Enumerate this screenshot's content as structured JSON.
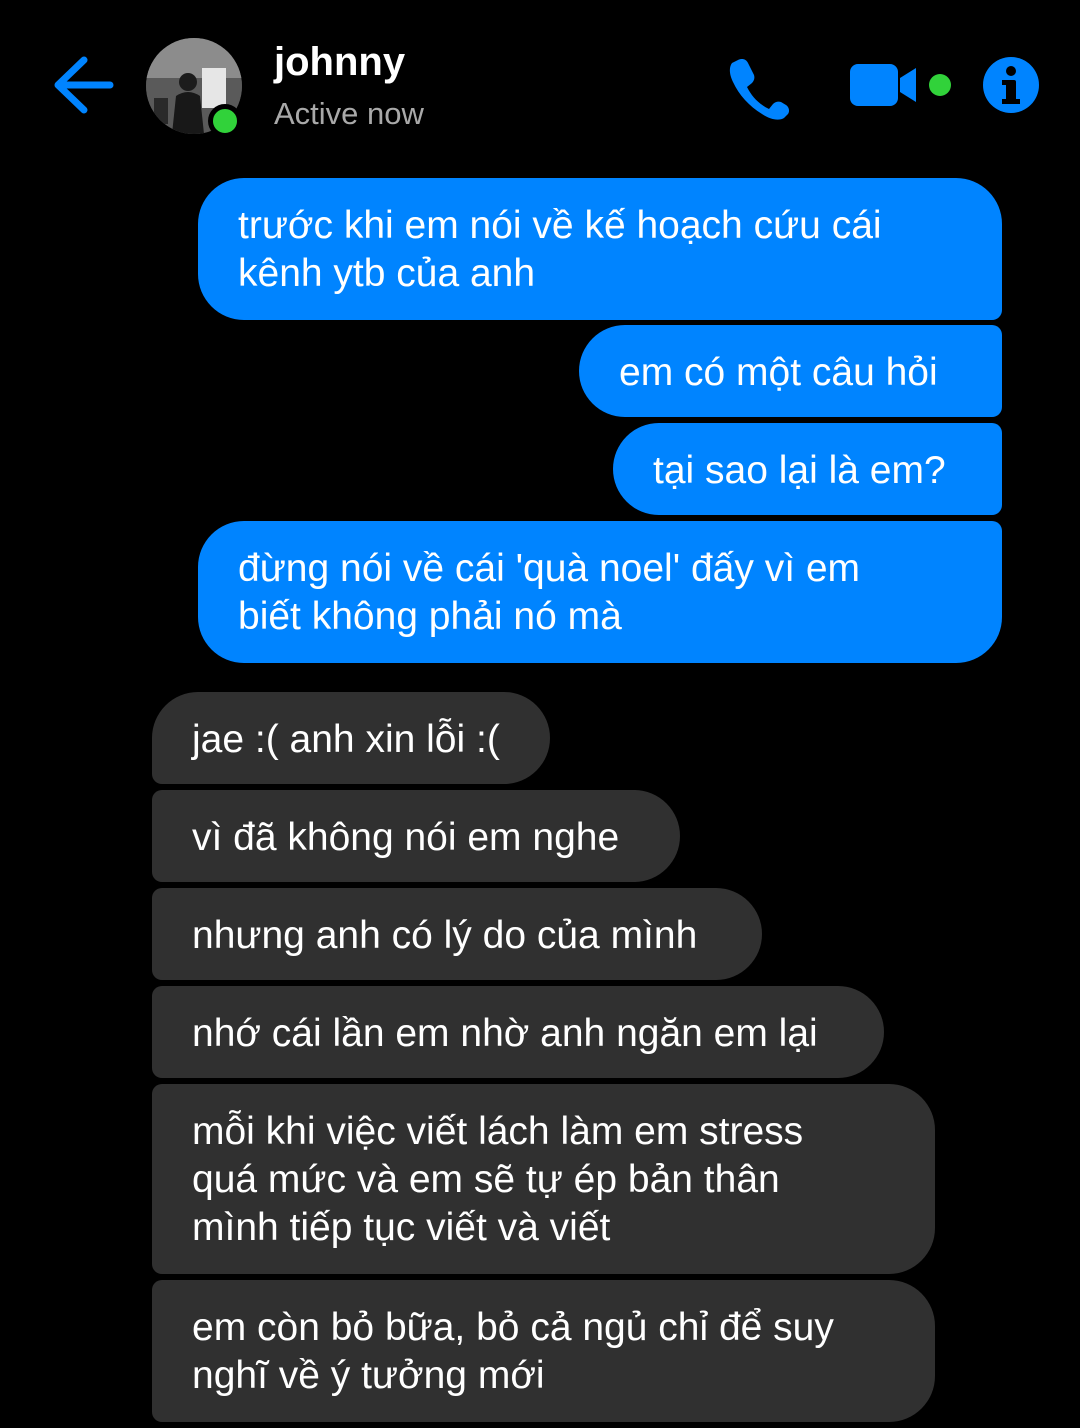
{
  "header": {
    "contact_name": "johnny",
    "status": "Active now",
    "icons": [
      "back-arrow-icon",
      "phone-icon",
      "video-camera-icon",
      "info-icon"
    ],
    "accent_color": "#0084ff",
    "online_color": "#31d23a"
  },
  "messages": {
    "outgoing": [
      {
        "lines": [
          "trước khi em nói về kế hoạch cứu cái",
          "kênh ytb của anh"
        ]
      },
      {
        "lines": [
          "em có một câu hỏi"
        ]
      },
      {
        "lines": [
          "tại sao lại là em?"
        ]
      },
      {
        "lines": [
          "đừng nói về cái 'quà noel' đấy vì em",
          "biết không phải nó mà"
        ]
      }
    ],
    "incoming": [
      {
        "lines": [
          "jae :( anh xin lỗi :("
        ]
      },
      {
        "lines": [
          "vì đã không nói em nghe"
        ]
      },
      {
        "lines": [
          "nhưng anh có lý do của mình"
        ]
      },
      {
        "lines": [
          "nhớ cái lần em nhờ anh ngăn em lại"
        ]
      },
      {
        "lines": [
          "mỗi khi việc viết lách làm em stress",
          "quá mức và em sẽ tự ép bản thân",
          "mình tiếp tục viết và viết"
        ]
      },
      {
        "lines": [
          "em còn bỏ bữa, bỏ cả ngủ chỉ để suy",
          "nghĩ về ý tưởng mới"
        ]
      }
    ],
    "outgoing_color": "#0084ff",
    "incoming_color": "#303030"
  }
}
